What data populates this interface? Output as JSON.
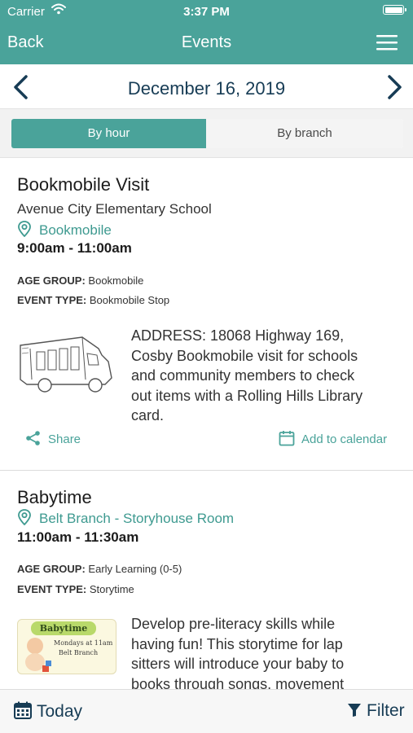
{
  "status_bar": {
    "carrier": "Carrier",
    "time": "3:37 PM"
  },
  "nav": {
    "back_label": "Back",
    "title": "Events"
  },
  "date_row": {
    "date": "December 16, 2019"
  },
  "segments": {
    "by_hour": "By hour",
    "by_branch": "By branch",
    "selected": "By hour"
  },
  "events": [
    {
      "title": "Bookmobile Visit",
      "subtitle": "Avenue City Elementary School",
      "location": "Bookmobile",
      "time": "9:00am - 11:00am",
      "age_group_label": "AGE GROUP:",
      "age_group_value": "Bookmobile",
      "event_type_label": "EVENT TYPE:",
      "event_type_value": "Bookmobile Stop",
      "description_lines": [
        "ADDRESS: 18068 Highway 169,",
        "Cosby Bookmobile visit for schools",
        "and community members to check",
        "out items with a Rolling Hills Library",
        "card."
      ],
      "share_label": "Share",
      "calendar_label": "Add to calendar"
    },
    {
      "title": "Babytime",
      "location": "Belt Branch - Storyhouse Room",
      "time": "11:00am - 11:30am",
      "age_group_label": "AGE GROUP:",
      "age_group_value": "Early Learning (0-5)",
      "event_type_label": "EVENT TYPE:",
      "event_type_value": "Storytime",
      "image_lines": [
        "Babytime",
        "Mondays at 11am",
        "Belt Branch"
      ],
      "description_lines": [
        "Develop pre-literacy skills while",
        "having fun! This storytime for lap",
        "sitters will introduce your baby to",
        "books through songs, movement"
      ]
    }
  ],
  "toolbar": {
    "today_label": "Today",
    "filter_label": "Filter"
  },
  "colors": {
    "primary": "#4aa39a",
    "dark_text": "#173c55",
    "toolbar_bg": "#f7f7f7"
  },
  "icons": [
    "wifi-icon",
    "battery-icon",
    "hamburger-menu-icon",
    "chevron-left-icon",
    "chevron-right-icon",
    "location-pin-icon",
    "share-icon",
    "calendar-icon",
    "filter-icon"
  ]
}
